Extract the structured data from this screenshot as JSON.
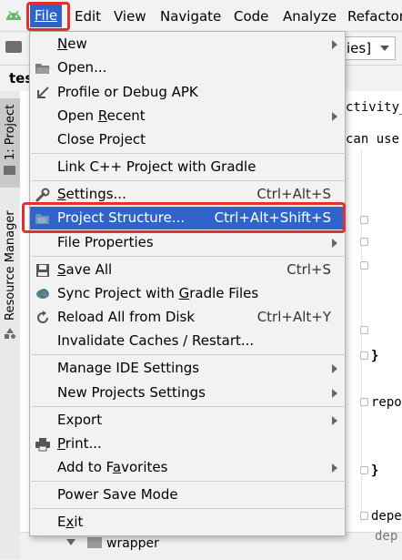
{
  "menubar": {
    "items": [
      {
        "label": "File",
        "u": "F"
      },
      {
        "label": "Edit",
        "u": "E"
      },
      {
        "label": "View",
        "u": "V"
      },
      {
        "label": "Navigate",
        "u": "N"
      },
      {
        "label": "Code",
        "u": "C"
      },
      {
        "label": "Analyze",
        "u": "z"
      },
      {
        "label": "Refactor",
        "u": "R"
      }
    ]
  },
  "toolbar": {
    "combo_text": "ies]"
  },
  "tab_fragment": "tes",
  "left_strip": {
    "project_tab": "1: Project",
    "resource_manager": "Resource Manager"
  },
  "editor": {
    "frag1": "ctivity_ma",
    "frag2": "can use t",
    "brace": "}",
    "repo": "repo",
    "brace2": "}",
    "depe": "depe",
    "dep": "dep"
  },
  "bottom_tree": {
    "label": "wrapper"
  },
  "file_menu": {
    "items": [
      {
        "label": "New",
        "shortcut": "",
        "submenu": true
      },
      {
        "label": "Open...",
        "shortcut": "",
        "submenu": false
      },
      {
        "label": "Profile or Debug APK",
        "shortcut": "",
        "submenu": false
      },
      {
        "label": "Open Recent",
        "shortcut": "",
        "submenu": true
      },
      {
        "label": "Close Project",
        "shortcut": "",
        "submenu": false
      },
      {
        "label": "Link C++ Project with Gradle",
        "shortcut": "",
        "submenu": false
      },
      {
        "label": "Settings...",
        "shortcut": "Ctrl+Alt+S",
        "submenu": false
      },
      {
        "label": "Project Structure...",
        "shortcut": "Ctrl+Alt+Shift+S",
        "submenu": false,
        "selected": true
      },
      {
        "label": "File Properties",
        "shortcut": "",
        "submenu": true
      },
      {
        "label": "Save All",
        "shortcut": "Ctrl+S",
        "submenu": false
      },
      {
        "label": "Sync Project with Gradle Files",
        "shortcut": "",
        "submenu": false
      },
      {
        "label": "Reload All from Disk",
        "shortcut": "Ctrl+Alt+Y",
        "submenu": false
      },
      {
        "label": "Invalidate Caches / Restart...",
        "shortcut": "",
        "submenu": false
      },
      {
        "label": "Manage IDE Settings",
        "shortcut": "",
        "submenu": true
      },
      {
        "label": "New Projects Settings",
        "shortcut": "",
        "submenu": true
      },
      {
        "label": "Export",
        "shortcut": "",
        "submenu": true
      },
      {
        "label": "Print...",
        "shortcut": "",
        "submenu": false
      },
      {
        "label": "Add to Favorites",
        "shortcut": "",
        "submenu": true
      },
      {
        "label": "Power Save Mode",
        "shortcut": "",
        "submenu": false
      },
      {
        "label": "Exit",
        "shortcut": "",
        "submenu": false
      }
    ]
  },
  "colors": {
    "selection": "#2f65ca",
    "highlight_box": "#e03030"
  }
}
